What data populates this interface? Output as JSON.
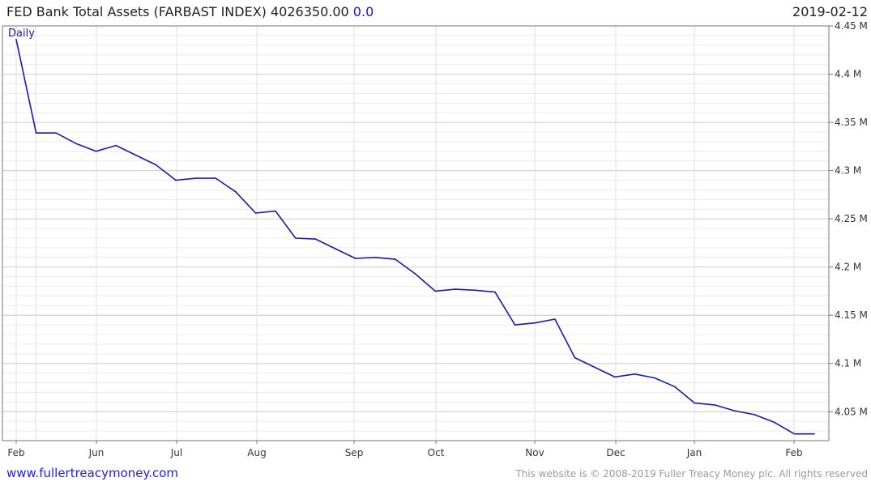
{
  "header": {
    "name": "FED Bank Total Assets (FARBAST INDEX)",
    "last": "4026350.00",
    "change": "0.0",
    "date": "2019-02-12"
  },
  "footer": {
    "site": "www.fullertreacymoney.com",
    "copyright": "This website is © 2008-2019 Fuller Treacy Money plc. All rights reserved"
  },
  "colors": {
    "line": "#1a1aaa",
    "grid": "#cfcfcf",
    "frame": "#777777"
  },
  "chart_data": {
    "type": "line",
    "title": "FED Bank Total Assets (FARBAST INDEX)",
    "period_label": "Daily",
    "x_ticks": [
      "Feb",
      "Jun",
      "Jul",
      "Aug",
      "Sep",
      "Oct",
      "Nov",
      "Dec",
      "Jan",
      "Feb"
    ],
    "y_ticks": [
      {
        "v": 4.05,
        "label": "4.05 M"
      },
      {
        "v": 4.1,
        "label": "4.1 M"
      },
      {
        "v": 4.15,
        "label": "4.15 M"
      },
      {
        "v": 4.2,
        "label": "4.2 M"
      },
      {
        "v": 4.25,
        "label": "4.25 M"
      },
      {
        "v": 4.3,
        "label": "4.3 M"
      },
      {
        "v": 4.35,
        "label": "4.35 M"
      },
      {
        "v": 4.4,
        "label": "4.4 M"
      },
      {
        "v": 4.45,
        "label": "4.45 M"
      }
    ],
    "ylim": [
      4.02,
      4.45
    ],
    "grid": true,
    "series": [
      {
        "values": [
          4.436,
          4.339,
          4.339,
          4.328,
          4.32,
          4.326,
          4.316,
          4.306,
          4.29,
          4.292,
          4.292,
          4.278,
          4.256,
          4.258,
          4.23,
          4.229,
          4.219,
          4.209,
          4.21,
          4.208,
          4.193,
          4.175,
          4.177,
          4.176,
          4.174,
          4.14,
          4.142,
          4.146,
          4.106,
          4.096,
          4.086,
          4.089,
          4.085,
          4.076,
          4.059,
          4.057,
          4.051,
          4.047,
          4.039,
          4.027,
          4.027
        ]
      }
    ]
  }
}
